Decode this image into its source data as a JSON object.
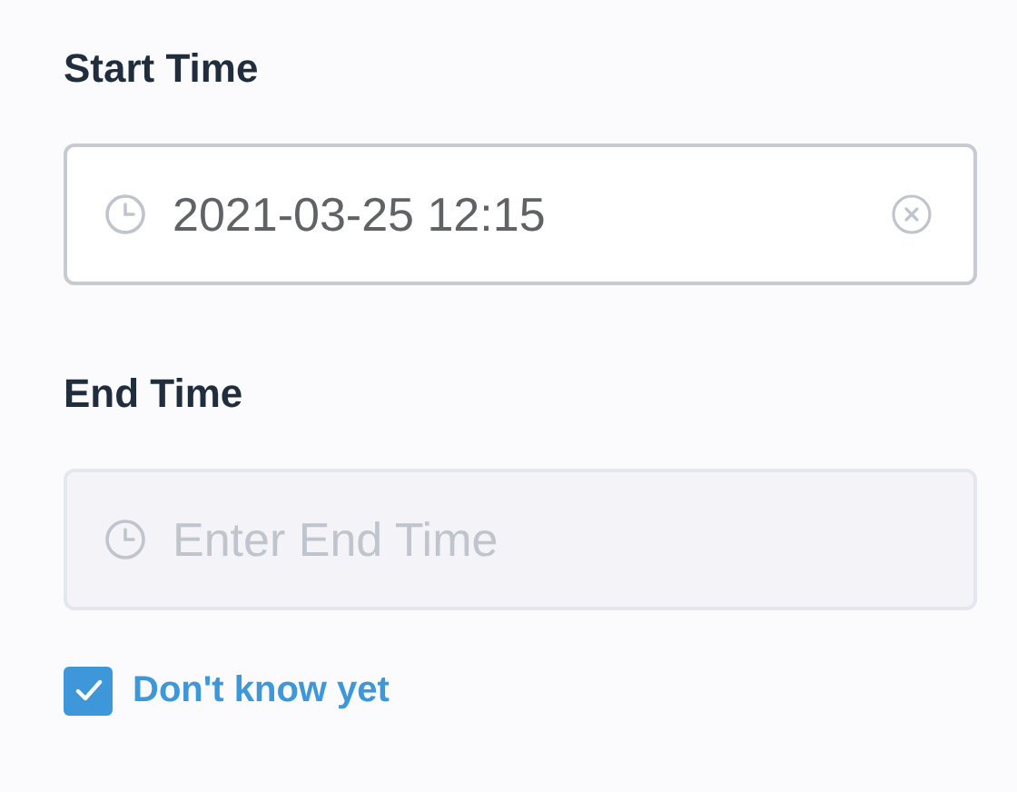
{
  "fields": [
    {
      "label": "Start Time",
      "value": "2021-03-25 12:15",
      "disabled": false,
      "clearable": true
    },
    {
      "label": "End Time",
      "placeholder": "Enter End Time",
      "disabled": true
    }
  ],
  "checkbox": {
    "label": "Don't know yet",
    "checked": true
  }
}
